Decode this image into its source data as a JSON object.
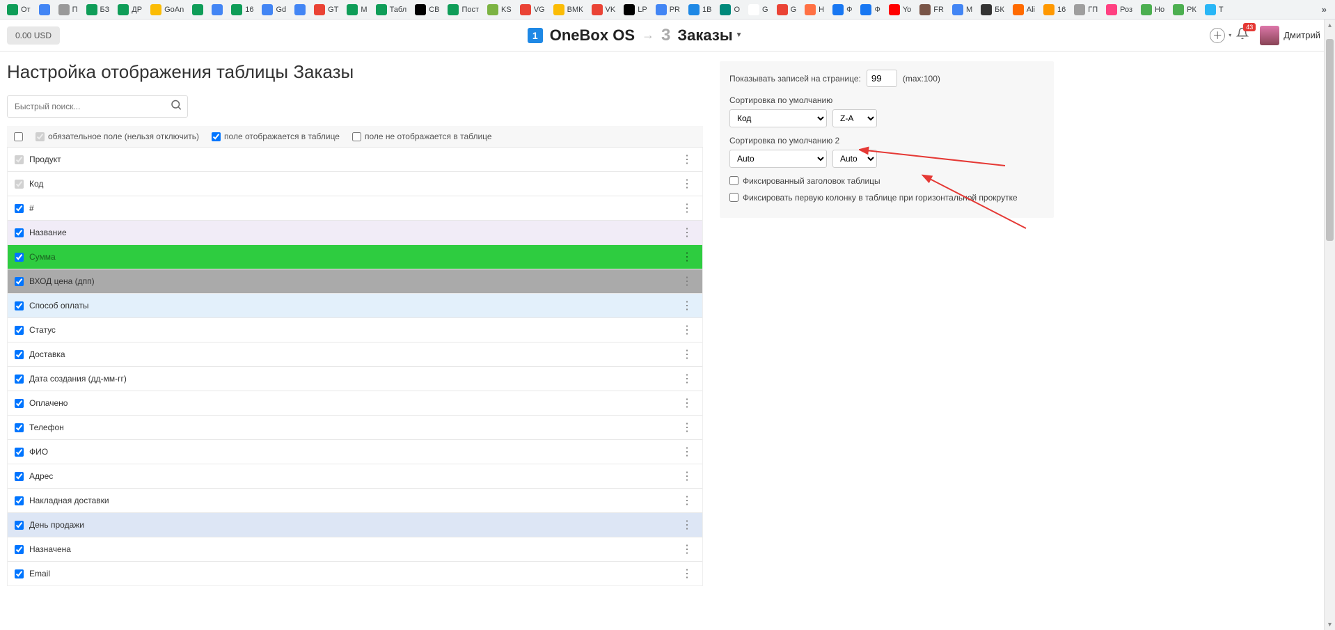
{
  "bookmarks": [
    {
      "label": "От",
      "bg": "#0f9d58"
    },
    {
      "label": "",
      "bg": "#4285f4"
    },
    {
      "label": "П",
      "bg": "#999"
    },
    {
      "label": "БЗ",
      "bg": "#0f9d58"
    },
    {
      "label": "ДР",
      "bg": "#0f9d58"
    },
    {
      "label": "GoAn",
      "bg": "#fbbc05"
    },
    {
      "label": "",
      "bg": "#0f9d58"
    },
    {
      "label": "",
      "bg": "#4285f4"
    },
    {
      "label": "16",
      "bg": "#0f9d58"
    },
    {
      "label": "Gd",
      "bg": "#4285f4"
    },
    {
      "label": "",
      "bg": "#4285f4"
    },
    {
      "label": "GT",
      "bg": "#ea4335"
    },
    {
      "label": "М",
      "bg": "#0f9d58"
    },
    {
      "label": "Табл",
      "bg": "#0f9d58"
    },
    {
      "label": "СВ",
      "bg": "#000"
    },
    {
      "label": "Пост",
      "bg": "#0f9d58"
    },
    {
      "label": "KS",
      "bg": "#7cb342"
    },
    {
      "label": "VG",
      "bg": "#ea4335"
    },
    {
      "label": "ВМК",
      "bg": "#fbbc05"
    },
    {
      "label": "VK",
      "bg": "#ea4335"
    },
    {
      "label": "LP",
      "bg": "#000"
    },
    {
      "label": "PR",
      "bg": "#4285f4"
    },
    {
      "label": "1В",
      "bg": "#1e88e5"
    },
    {
      "label": "О",
      "bg": "#00897b"
    },
    {
      "label": "G",
      "bg": "#fff"
    },
    {
      "label": "G",
      "bg": "#ea4335"
    },
    {
      "label": "Н",
      "bg": "#ff7043"
    },
    {
      "label": "Ф",
      "bg": "#1877f2"
    },
    {
      "label": "Ф",
      "bg": "#1877f2"
    },
    {
      "label": "Yo",
      "bg": "#ff0000"
    },
    {
      "label": "FR",
      "bg": "#795548"
    },
    {
      "label": "М",
      "bg": "#4285f4"
    },
    {
      "label": "БК",
      "bg": "#333"
    },
    {
      "label": "Ali",
      "bg": "#ff6a00"
    },
    {
      "label": "16",
      "bg": "#ff9800"
    },
    {
      "label": "ГП",
      "bg": "#9e9e9e"
    },
    {
      "label": "Роз",
      "bg": "#ff4081"
    },
    {
      "label": "Но",
      "bg": "#4caf50"
    },
    {
      "label": "РК",
      "bg": "#4caf50"
    },
    {
      "label": "Т",
      "bg": "#29b6f6"
    }
  ],
  "appbar": {
    "balance": "0.00 USD",
    "brand": "OneBox OS",
    "section_num": "3",
    "section_title": "Заказы",
    "notif_count": "43",
    "user_name": "Дмитрий"
  },
  "page_title": "Настройка отображения таблицы Заказы",
  "search_placeholder": "Быстрый поиск...",
  "legend": {
    "required": "обязательное поле (нельзя отключить)",
    "shown": "поле отображается в таблице",
    "hidden": "поле не отображается в таблице"
  },
  "fields": [
    {
      "label": "Продукт",
      "cls": "row-white",
      "disabled": true,
      "checked": true
    },
    {
      "label": "Код",
      "cls": "row-white",
      "disabled": true,
      "checked": true
    },
    {
      "label": "#",
      "cls": "row-white",
      "disabled": false,
      "checked": true
    },
    {
      "label": "Название",
      "cls": "row-lav",
      "disabled": false,
      "checked": true
    },
    {
      "label": "Сумма",
      "cls": "row-green",
      "disabled": false,
      "checked": true
    },
    {
      "label": "ВХОД цена (дпп)",
      "cls": "row-gray",
      "disabled": false,
      "checked": true
    },
    {
      "label": "Способ оплаты",
      "cls": "row-blue",
      "disabled": false,
      "checked": true
    },
    {
      "label": "Статус",
      "cls": "row-white",
      "disabled": false,
      "checked": true
    },
    {
      "label": "Доставка",
      "cls": "row-white",
      "disabled": false,
      "checked": true
    },
    {
      "label": "Дата создания (дд-мм-гг)",
      "cls": "row-white",
      "disabled": false,
      "checked": true
    },
    {
      "label": "Оплачено",
      "cls": "row-white",
      "disabled": false,
      "checked": true
    },
    {
      "label": "Телефон",
      "cls": "row-white",
      "disabled": false,
      "checked": true
    },
    {
      "label": "ФИО",
      "cls": "row-white",
      "disabled": false,
      "checked": true
    },
    {
      "label": "Адрес",
      "cls": "row-white",
      "disabled": false,
      "checked": true
    },
    {
      "label": "Накладная доставки",
      "cls": "row-white",
      "disabled": false,
      "checked": true
    },
    {
      "label": "День продажи",
      "cls": "row-lblue",
      "disabled": false,
      "checked": true
    },
    {
      "label": "Назначена",
      "cls": "row-white",
      "disabled": false,
      "checked": true
    },
    {
      "label": "Email",
      "cls": "row-white",
      "disabled": false,
      "checked": true
    }
  ],
  "right_panel": {
    "records_label": "Показывать записей на странице:",
    "records_value": "99",
    "records_max": "(max:100)",
    "sort1_label": "Сортировка по умолчанию",
    "sort1_field": "Код",
    "sort1_dir": "Z-A",
    "sort2_label": "Сортировка по умолчанию 2",
    "sort2_field": "Auto",
    "sort2_dir": "Auto",
    "fix_header": "Фиксированный заголовок таблицы",
    "fix_first_col": "Фиксировать первую колонку в таблице при горизонтальной прокрутке"
  }
}
